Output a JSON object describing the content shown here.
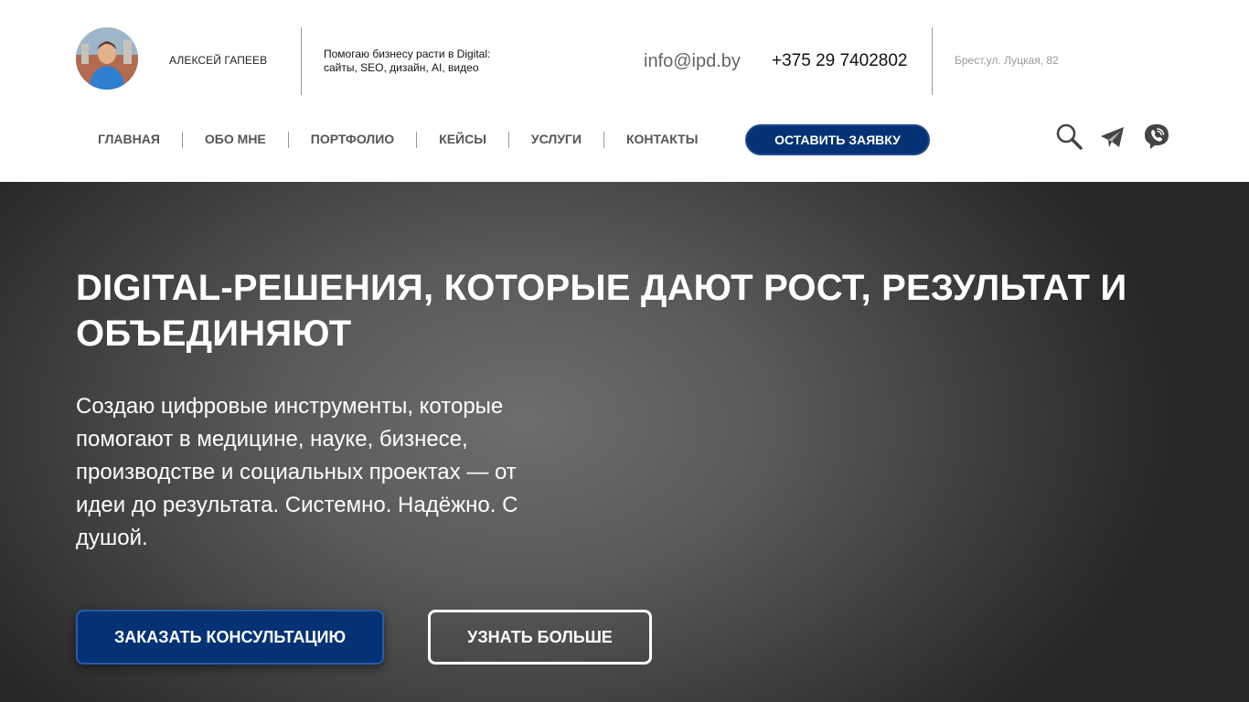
{
  "header": {
    "name": "АЛЕКСЕЙ ГАПЕЕВ",
    "tagline_line1": "Помогаю бизнесу расти в Digital:",
    "tagline_line2": "сайты, SEO, дизайн, AI, видео",
    "email": "info@ipd.by",
    "phone": "+375 29 7402802",
    "address": "Брест,ул. Луцкая, 82"
  },
  "nav": {
    "items": [
      {
        "label": "ГЛАВНАЯ"
      },
      {
        "label": "ОБО МНЕ"
      },
      {
        "label": "ПОРТФОЛИО"
      },
      {
        "label": "КЕЙСЫ"
      },
      {
        "label": "УСЛУГИ"
      },
      {
        "label": "КОНТАКТЫ"
      }
    ],
    "cta_label": "ОСТАВИТЬ ЗАЯВКУ",
    "icons": [
      "search-icon",
      "telegram-icon",
      "viber-icon"
    ]
  },
  "hero": {
    "title": "DIGITAL-РЕШЕНИЯ, КОТОРЫЕ ДАЮТ РОСТ, РЕЗУЛЬТАТ И ОБЪЕДИНЯЮТ",
    "text": "Создаю цифровые инструменты, которые помогают в медицине, науке, бизнесе, производстве и социальных проектах — от идеи до результата. Системно. Надёжно. С душой.",
    "primary_button": "ЗАКАЗАТЬ КОНСУЛЬТАЦИЮ",
    "secondary_button": "УЗНАТЬ БОЛЬШЕ"
  },
  "colors": {
    "brand_blue": "#043274",
    "hero_background": "#4a4a4a",
    "nav_text": "#555555"
  }
}
